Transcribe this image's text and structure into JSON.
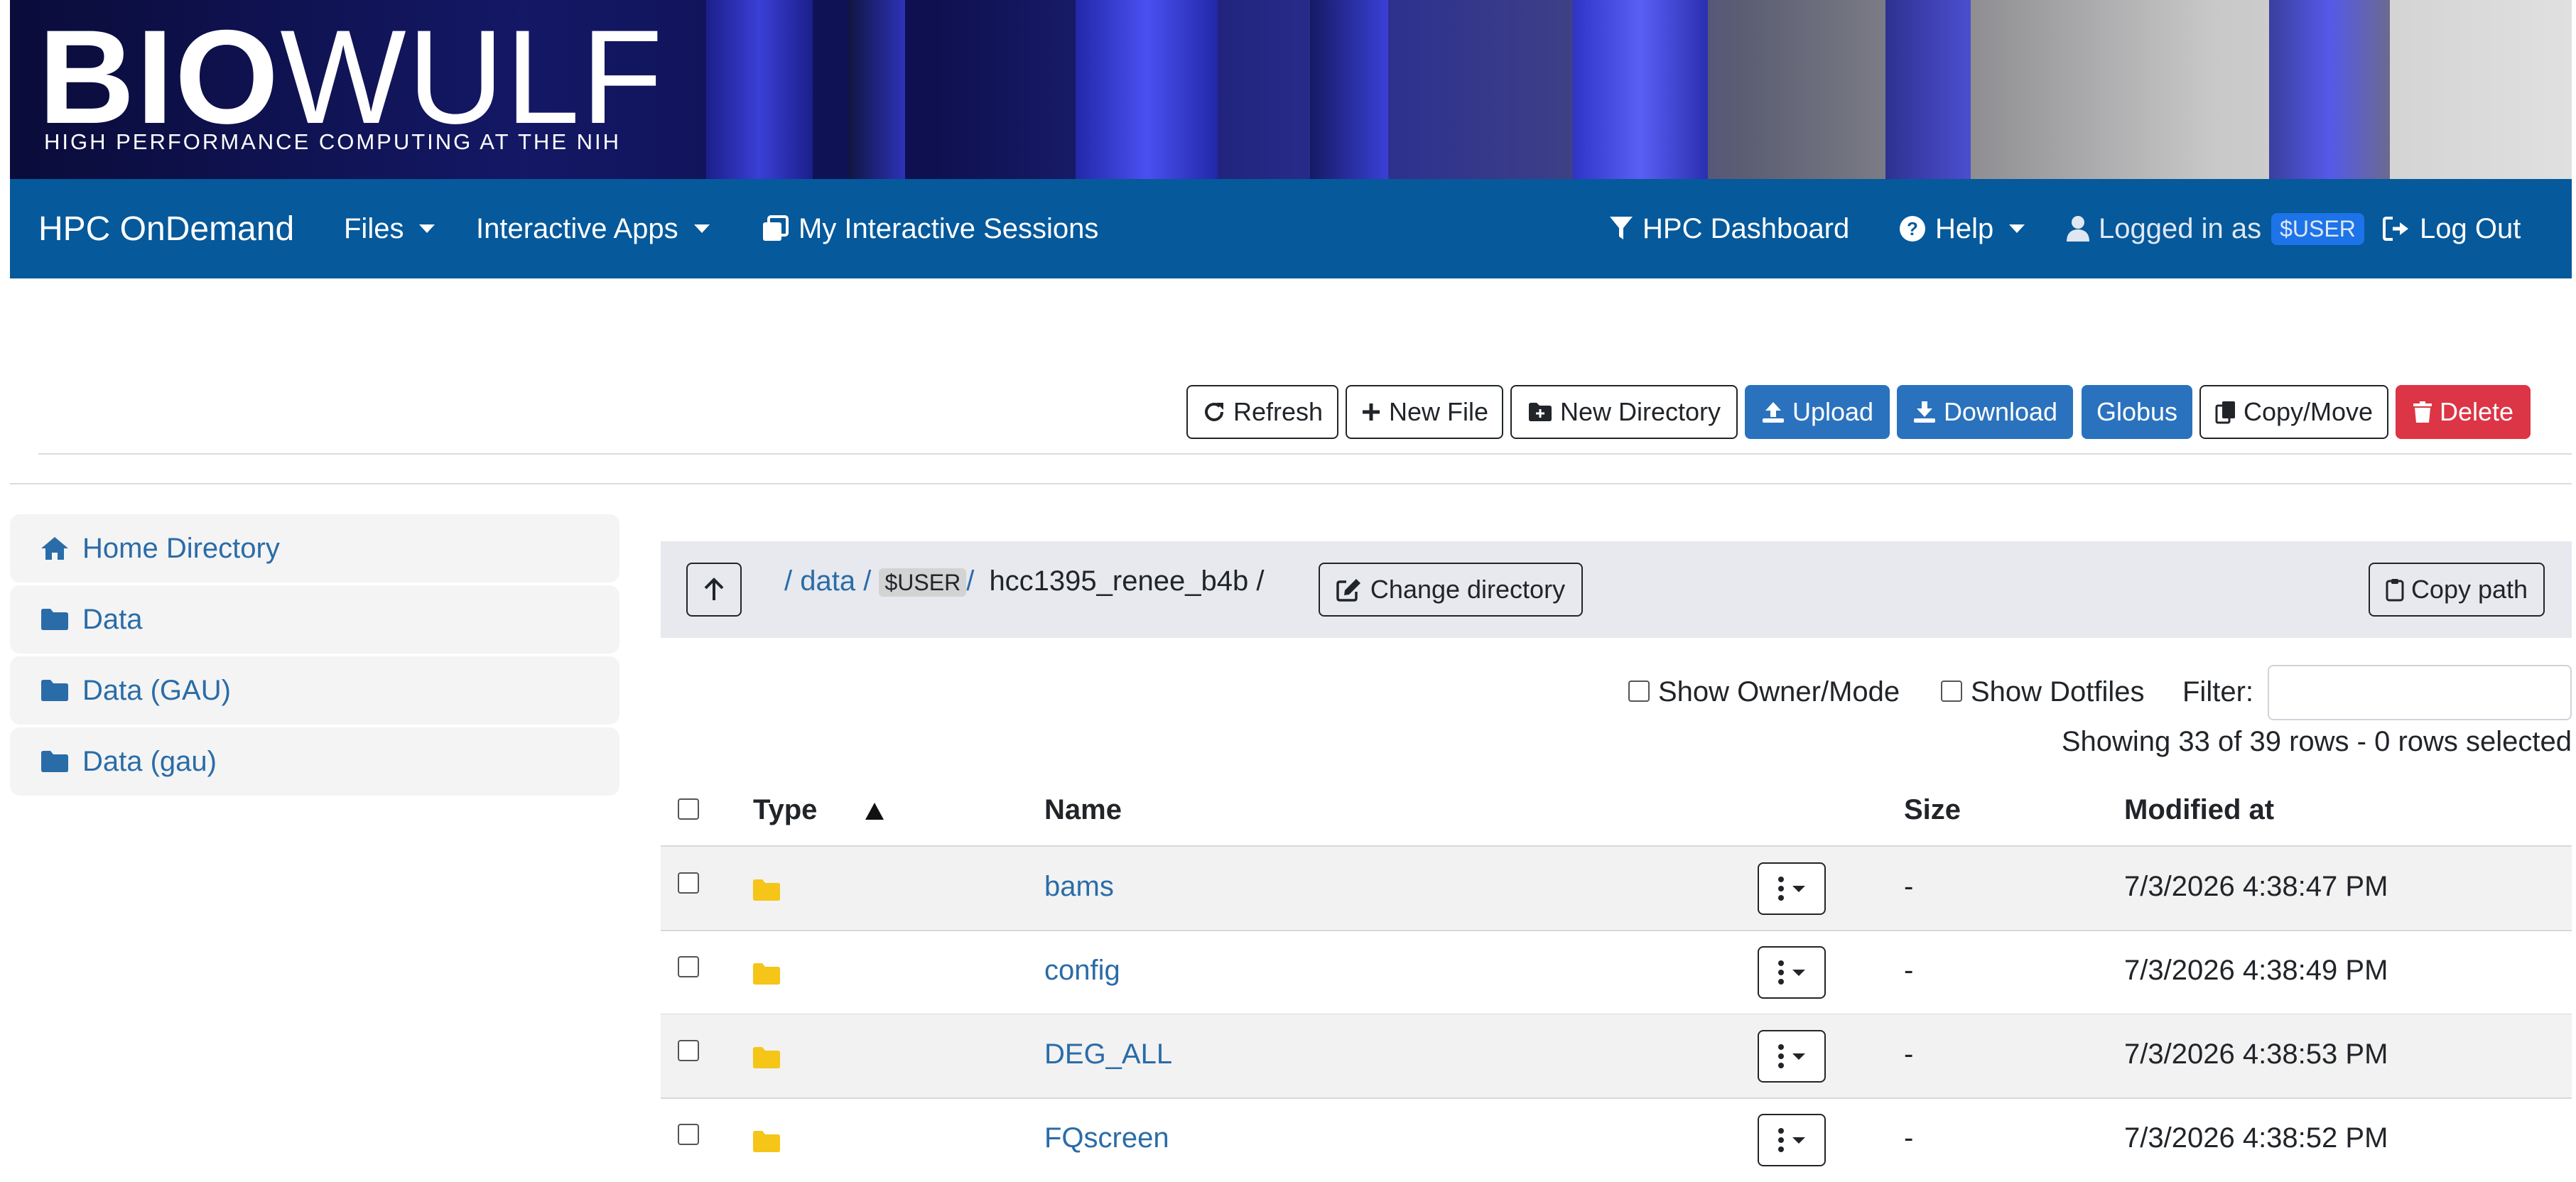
{
  "banner": {
    "logo_bold": "BIO",
    "logo_thin": "WULF",
    "tagline": "HIGH PERFORMANCE COMPUTING AT THE NIH"
  },
  "navbar": {
    "brand": "HPC OnDemand",
    "files": "Files",
    "interactive_apps": "Interactive Apps",
    "sessions": "My Interactive Sessions",
    "dashboard": "HPC Dashboard",
    "help": "Help",
    "logged_in_as": "Logged in as",
    "user": "$USER",
    "logout": "Log Out",
    "color": "#06599a"
  },
  "toolbar": {
    "refresh": "Refresh",
    "new_file": "New File",
    "new_directory": "New Directory",
    "upload": "Upload",
    "download": "Download",
    "globus": "Globus",
    "copy_move": "Copy/Move",
    "delete": "Delete"
  },
  "sidebar": {
    "items": [
      {
        "label": "Home Directory",
        "icon": "home-icon"
      },
      {
        "label": "Data",
        "icon": "folder-icon"
      },
      {
        "label": "Data (GAU)",
        "icon": "folder-icon"
      },
      {
        "label": "Data (gau)",
        "icon": "folder-icon"
      }
    ]
  },
  "path": {
    "sep": "/",
    "data": "data",
    "user": "$USER",
    "current": "hcc1395_renee_b4b /",
    "change_directory": "Change directory",
    "copy_path": "Copy path"
  },
  "options": {
    "show_owner_mode": "Show Owner/Mode",
    "show_dotfiles": "Show Dotfiles",
    "filter_label": "Filter:",
    "filter_value": "",
    "status": "Showing 33 of 39 rows - 0 rows selected"
  },
  "table": {
    "headers": {
      "type": "Type",
      "name": "Name",
      "size": "Size",
      "modified": "Modified at"
    },
    "rows": [
      {
        "name": "bams",
        "size": "-",
        "modified": "7/3/2026 4:38:47 PM"
      },
      {
        "name": "config",
        "size": "-",
        "modified": "7/3/2026 4:38:49 PM"
      },
      {
        "name": "DEG_ALL",
        "size": "-",
        "modified": "7/3/2026 4:38:53 PM"
      },
      {
        "name": "FQscreen",
        "size": "-",
        "modified": "7/3/2026 4:38:52 PM"
      }
    ]
  },
  "colors": {
    "link": "#2a6ca8",
    "primary_button": "#2a72bd",
    "danger_button": "#dc3545",
    "folder": "#f5c518"
  }
}
